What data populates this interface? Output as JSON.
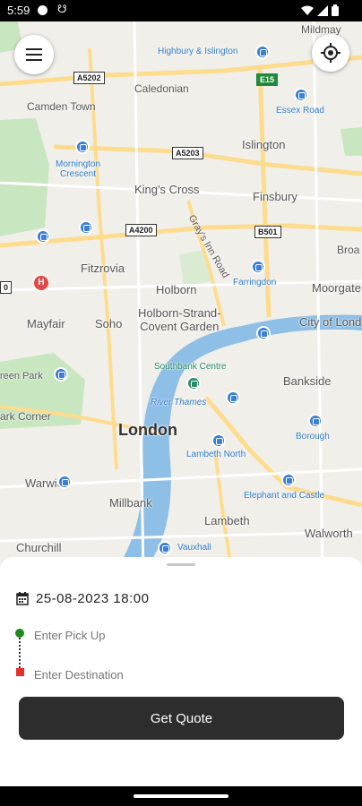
{
  "status_bar": {
    "time": "5:59",
    "icons": [
      "circle-notification-icon",
      "usb-icon",
      "wifi-icon",
      "cell-signal-icon",
      "battery-icon"
    ]
  },
  "map": {
    "labels": {
      "mildmay": "Mildmay",
      "highbury": "Highbury & Islington",
      "caledonian": "Caledonian",
      "camden": "Camden Town",
      "essex_road": "Essex Road",
      "islington": "Islington",
      "mornington": "Mornington\nCrescent",
      "kings_cross": "King's Cross",
      "finsbury": "Finsbury",
      "grays_inn": "Gray's Inn Road",
      "broad": "Broa",
      "fitzrovia": "Fitzrovia",
      "farringdon": "Farringdon",
      "holborn": "Holborn",
      "moorgate": "Moorgate",
      "mayfair": "Mayfair",
      "soho": "Soho",
      "holborn_strand": "Holborn-Strand-\nCovent Garden",
      "city_of_london": "City of Lond",
      "southbank": "Southbank Centre",
      "river_thames": "River Thames",
      "green_park": "reen Park",
      "bankside": "Bankside",
      "park_corner": "ark Corner",
      "london": "London",
      "borough": "Borough",
      "lambeth_north": "Lambeth North",
      "warwick": "Warwick",
      "millbank": "Millbank",
      "elephant": "Elephant and Castle",
      "lambeth": "Lambeth",
      "walworth": "Walworth",
      "churchill": "Churchill",
      "vauxhall": "Vauxhall"
    },
    "road_badges": {
      "a5202": "A5202",
      "a5203": "A5203",
      "e15": "E15",
      "a4200": "A4200",
      "b501": "B501",
      "b_left": "0"
    },
    "colors": {
      "land": "#f1efea",
      "park": "#c8e6c0",
      "water": "#8ebfe6",
      "road_major": "#fddc8e",
      "road_minor": "#ffffff",
      "station": "#3b7fd6"
    }
  },
  "booking": {
    "datetime": "25-08-2023 18:00",
    "pickup_placeholder": "Enter Pick Up",
    "destination_placeholder": "Enter Destination",
    "quote_label": "Get Quote",
    "colors": {
      "pickup": "#1e8a1e",
      "destination": "#e63030",
      "button": "#2d2d2d"
    }
  }
}
